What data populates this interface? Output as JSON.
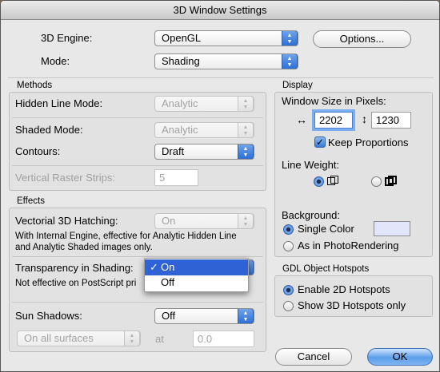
{
  "window": {
    "title": "3D Window Settings"
  },
  "top": {
    "engine_label": "3D Engine:",
    "engine_value": "OpenGL",
    "mode_label": "Mode:",
    "mode_value": "Shading",
    "options_button": "Options..."
  },
  "methods": {
    "title": "Methods",
    "hidden_line_label": "Hidden Line Mode:",
    "hidden_line_value": "Analytic",
    "shaded_label": "Shaded Mode:",
    "shaded_value": "Analytic",
    "contours_label": "Contours:",
    "contours_value": "Draft",
    "raster_label": "Vertical Raster Strips:",
    "raster_value": "5"
  },
  "effects": {
    "title": "Effects",
    "hatching_label": "Vectorial 3D Hatching:",
    "hatching_value": "On",
    "hatching_note_1": "With Internal Engine, effective for Analytic Hidden Line",
    "hatching_note_2": "and Analytic Shaded images only.",
    "transparency_label": "Transparency in Shading:",
    "transparency_note": "Not effective on PostScript pri",
    "transparency_menu": [
      "On",
      "Off"
    ],
    "check_mark": "✓",
    "sun_label": "Sun Shadows:",
    "sun_value": "Off",
    "surfaces_value": "On all surfaces",
    "at_label": "at",
    "at_value": "0.0"
  },
  "display": {
    "title": "Display",
    "size_label": "Window Size in Pixels:",
    "width_value": "2202",
    "height_value": "1230",
    "keep_label": "Keep Proportions",
    "line_weight_label": "Line Weight:",
    "background_label": "Background:",
    "single_color_label": "Single Color",
    "photo_label": "As in PhotoRendering",
    "swatch_color": "#e3e6fb"
  },
  "hotspots": {
    "title": "GDL Object Hotspots",
    "enable_2d": "Enable 2D Hotspots",
    "show_3d": "Show 3D Hotspots only"
  },
  "buttons": {
    "cancel": "Cancel",
    "ok": "OK"
  }
}
